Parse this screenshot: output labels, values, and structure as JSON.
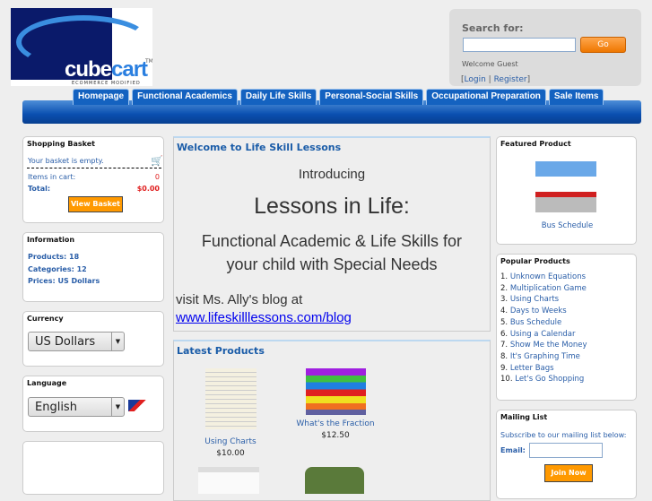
{
  "header": {
    "logo_text": "cubecart",
    "logo_tm": "TM",
    "logo_tagline": "ECOMMERCE MODIFIED",
    "search_label": "Search for:",
    "search_value": "",
    "go_label": "Go",
    "welcome": "Welcome Guest",
    "login": "Login",
    "register": "Register"
  },
  "nav": [
    "Homepage",
    "Functional Academics",
    "Daily Life Skills",
    "Personal-Social Skills",
    "Occupational Preparation",
    "Sale Items"
  ],
  "basket": {
    "title": "Shopping Basket",
    "empty": "Your basket is empty.",
    "items_label": "Items in cart:",
    "items": "0",
    "total_label": "Total:",
    "total": "$0.00",
    "button": "View Basket"
  },
  "info": {
    "title": "Information",
    "products": "Products: 18",
    "categories": "Categories: 12",
    "prices": "Prices: US Dollars"
  },
  "currency": {
    "title": "Currency",
    "selected": "US Dollars"
  },
  "language": {
    "title": "Language",
    "selected": "English"
  },
  "welcome": {
    "title": "Welcome to Life Skill Lessons",
    "intro": "Introducing",
    "headline": "Lessons in Life:",
    "sub1": "Functional Academic & Life Skills for",
    "sub2": "your child with Special Needs",
    "visit": "visit Ms. Ally's blog at",
    "link": "www.lifeskilllessons.com/blog"
  },
  "latest": {
    "title": "Latest Products",
    "items": [
      {
        "name": "Using Charts",
        "price": "$10.00"
      },
      {
        "name": "What's the Fraction",
        "price": "$12.50"
      }
    ]
  },
  "featured": {
    "title": "Featured Product",
    "name": "Bus Schedule"
  },
  "popular": {
    "title": "Popular Products",
    "items": [
      "1. ",
      "2. ",
      "3. ",
      "4. ",
      "5. ",
      "6. ",
      "7. ",
      "8. ",
      "9. ",
      "10. "
    ],
    "names": [
      "Unknown Equations",
      "Multiplication Game",
      "Using Charts",
      "Days to Weeks",
      "Bus Schedule",
      "Using a Calendar",
      "Show Me the Money",
      "It's Graphing Time",
      "Letter Bags",
      "Let's Go Shopping"
    ]
  },
  "mailing": {
    "title": "Mailing List",
    "text": "Subscribe to our mailing list below:",
    "email_label": "Email:",
    "email_value": "",
    "button": "Join Now"
  }
}
